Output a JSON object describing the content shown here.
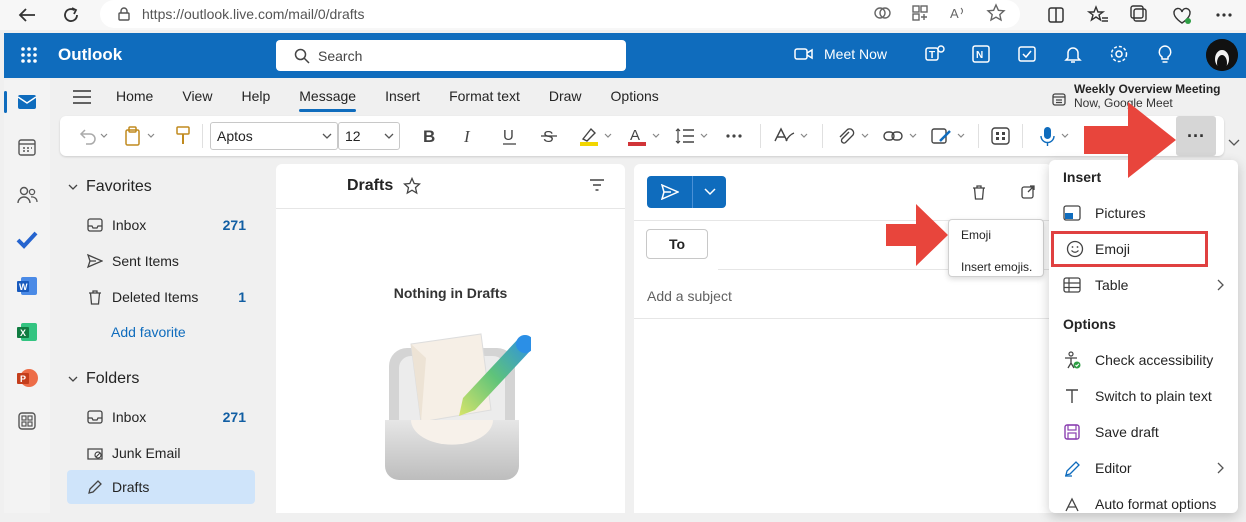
{
  "browser": {
    "url": "https://outlook.live.com/mail/0/drafts"
  },
  "header": {
    "brand": "Outlook",
    "search_placeholder": "Search",
    "meet_now": "Meet Now"
  },
  "tabs": [
    "Home",
    "View",
    "Help",
    "Message",
    "Insert",
    "Format text",
    "Draw",
    "Options"
  ],
  "active_tab": "Message",
  "meeting": {
    "title": "Weekly Overview Meeting",
    "subtitle": "Now, Google Meet"
  },
  "ribbon": {
    "font": "Aptos",
    "size": "12",
    "more_label": "···"
  },
  "folders": {
    "favorites_label": "Favorites",
    "favorites": [
      {
        "label": "Inbox",
        "count": "271"
      },
      {
        "label": "Sent Items",
        "count": ""
      },
      {
        "label": "Deleted Items",
        "count": "1"
      }
    ],
    "add_favorite": "Add favorite",
    "folders_label": "Folders",
    "folder_items": [
      {
        "label": "Inbox",
        "count": "271"
      },
      {
        "label": "Junk Email",
        "count": ""
      },
      {
        "label": "Drafts",
        "count": ""
      }
    ]
  },
  "message_list": {
    "title": "Drafts",
    "empty_text": "Nothing in Drafts"
  },
  "compose": {
    "to_label": "To",
    "subject_placeholder": "Add a subject"
  },
  "tooltip": {
    "title": "Emoji",
    "description": "Insert emojis."
  },
  "menu": {
    "insert_label": "Insert",
    "insert_items": [
      "Pictures",
      "Emoji",
      "Table"
    ],
    "options_label": "Options",
    "options_items": [
      "Check accessibility",
      "Switch to plain text",
      "Save draft",
      "Editor",
      "Auto format options"
    ]
  },
  "colors": {
    "brand": "#0f6cbd",
    "highlight_box": "#e04040",
    "arrow": "#e8453c"
  }
}
